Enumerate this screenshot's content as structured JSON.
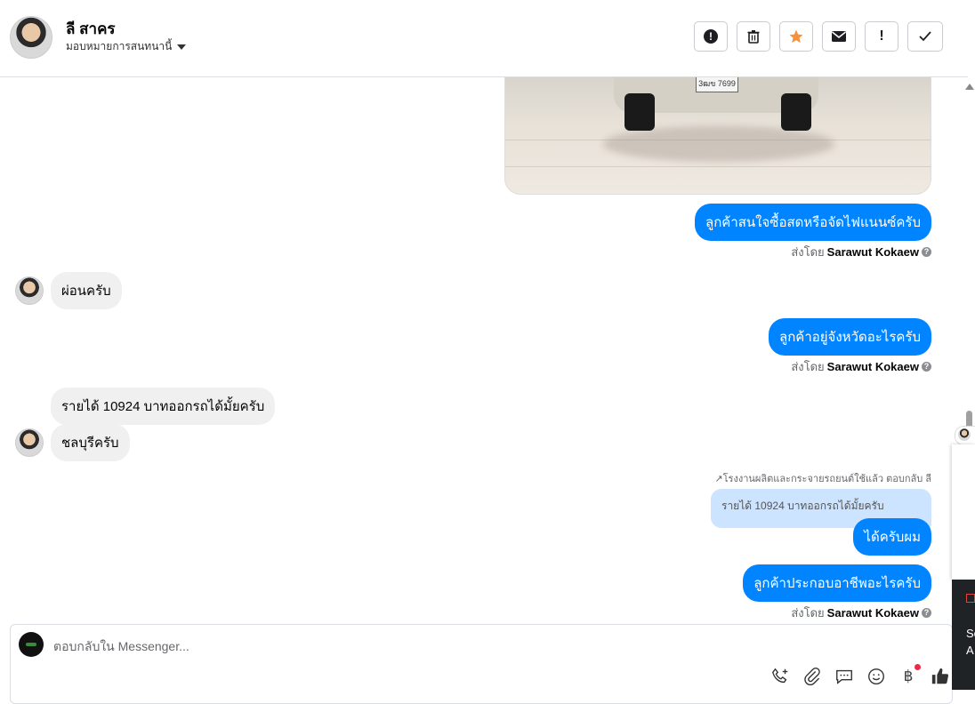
{
  "header": {
    "contact_name": "ลี สาคร",
    "assign_label": "มอบหมายการสนทนานี้",
    "toolbar": [
      {
        "name": "report-spam-button",
        "icon": "!"
      },
      {
        "name": "delete-button",
        "icon": "🗑"
      },
      {
        "name": "star-button",
        "icon": "★"
      },
      {
        "name": "mark-unread-button",
        "icon": "✉"
      },
      {
        "name": "follow-up-button",
        "icon": "!"
      },
      {
        "name": "mark-done-button",
        "icon": "✓"
      }
    ]
  },
  "photo": {
    "plate_text": "3ฒข 7699"
  },
  "messages": {
    "m1": {
      "text": "ลูกค้าสนใจซื้อสดหรือจัดไฟแนนซ์ครับ"
    },
    "m1_sent_prefix": "ส่งโดย",
    "m1_sent_by": "Sarawut Kokaew",
    "m2": {
      "text": "ผ่อนครับ"
    },
    "m3": {
      "text": "ลูกค้าอยู่จังหวัดอะไรครับ"
    },
    "m3_sent_prefix": "ส่งโดย",
    "m3_sent_by": "Sarawut Kokaew",
    "m4": {
      "text": "รายได้ 10924 บาทออกรถได้มั้ยครับ"
    },
    "m5": {
      "text": "ชลบุรีครับ"
    },
    "reply_note": "โรงงานผลิตและกระจายรถยนต์ใช้แล้ว ตอบกลับ ลี",
    "quoted_text": "รายได้ 10924 บาทออกรถได้มั้ยครับ",
    "m6": {
      "text": "ได้ครับผม"
    },
    "m7": {
      "text": "ลูกค้าประกอบอาชีพอะไรครับ"
    },
    "m7_sent_prefix": "ส่งโดย",
    "m7_sent_by": "Sarawut Kokaew"
  },
  "composer": {
    "placeholder": "ตอบกลับใน Messenger...",
    "icons": [
      "phone-plus-icon",
      "paperclip-icon",
      "saved-reply-icon",
      "emoji-icon",
      "baht-payment-icon",
      "thumbs-up-icon"
    ]
  },
  "side_panel": {
    "line1": "Se",
    "line2": "A"
  },
  "colors": {
    "accent": "#0084ff",
    "incoming": "#f0f0f0",
    "quoted": "#cce4ff",
    "star": "#f7923a"
  }
}
